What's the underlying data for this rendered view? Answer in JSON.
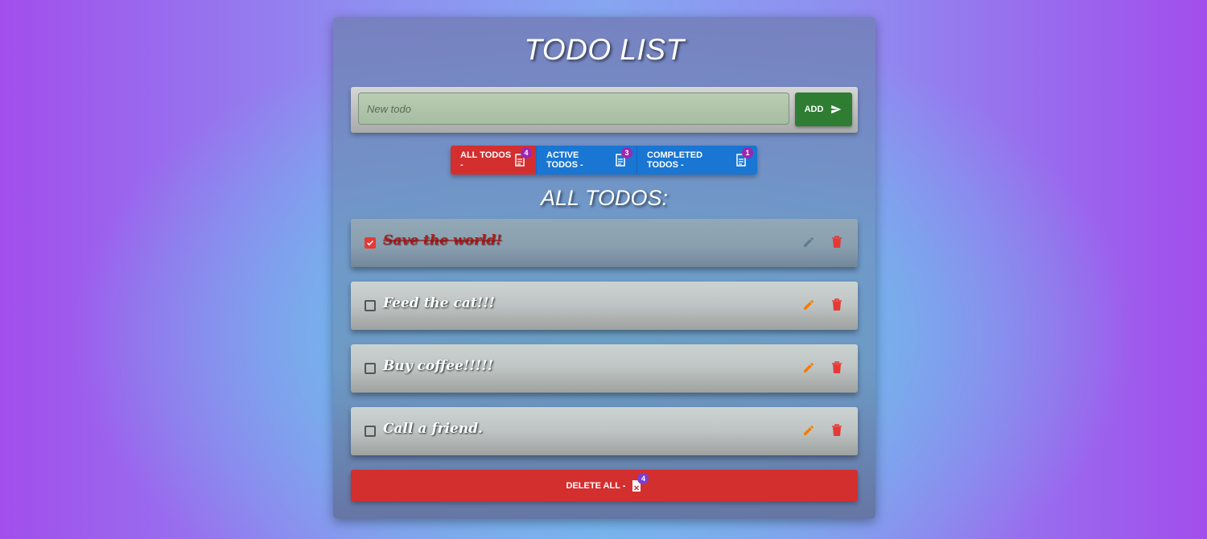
{
  "app": {
    "title": "TODO LIST"
  },
  "input": {
    "placeholder": "New todo",
    "value": ""
  },
  "add_button": {
    "label": "ADD",
    "icon": "send-icon"
  },
  "filters": [
    {
      "label": "ALL TODOS -",
      "count": "4",
      "icon": "document-icon",
      "color": "#d32f2f",
      "selected": true
    },
    {
      "label": "ACTIVE TODOS -",
      "count": "3",
      "icon": "document-icon",
      "color": "#1976d2",
      "selected": false
    },
    {
      "label": "COMPLETED TODOS -",
      "count": "1",
      "icon": "document-icon",
      "color": "#1976d2",
      "selected": false
    }
  ],
  "section_title": "ALL TODOS:",
  "todos": [
    {
      "text": "Save the world!",
      "completed": true
    },
    {
      "text": "Feed the cat!!!",
      "completed": false
    },
    {
      "text": "Buy coffee!!!!!",
      "completed": false
    },
    {
      "text": "Call a friend.",
      "completed": false
    }
  ],
  "delete_all": {
    "label": "DELETE ALL -",
    "count": "4",
    "icon": "delete-document-icon"
  },
  "colors": {
    "edit_active": "#f57c00",
    "edit_disabled": "#607d8b",
    "delete": "#e53935",
    "badge": "#9c27b0"
  }
}
